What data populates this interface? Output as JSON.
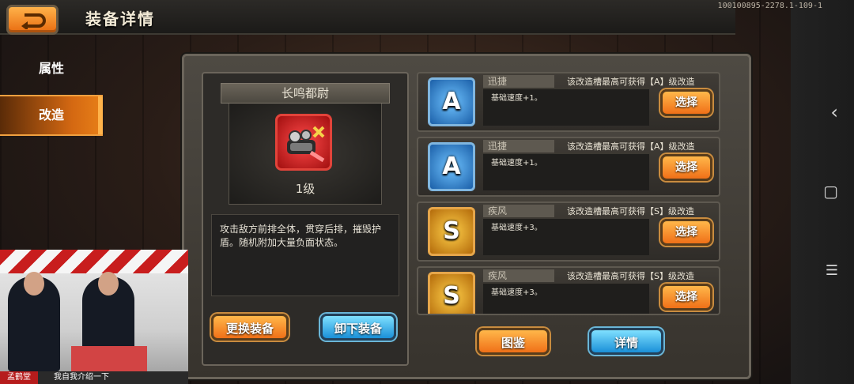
{
  "header": {
    "title": "装备详情",
    "code": "100100895-2278.1-109-1"
  },
  "nav": {
    "items": [
      {
        "label": "属性",
        "active": false
      },
      {
        "label": "改造",
        "active": true
      }
    ]
  },
  "equipment": {
    "name": "长鸣都尉",
    "level": "1级",
    "description": "攻击敌方前排全体，贯穿后排，摧毁护盾。随机附加大量负面状态。",
    "icon": "weapon-gauntlet-icon",
    "buttons": {
      "change": "更换装备",
      "unequip": "卸下装备"
    }
  },
  "slots": [
    {
      "grade": "A",
      "name": "迅捷",
      "info": "该改造槽最高可获得【A】级改造",
      "effect": "基础速度+1。",
      "button": "选择"
    },
    {
      "grade": "A",
      "name": "迅捷",
      "info": "该改造槽最高可获得【A】级改造",
      "effect": "基础速度+1。",
      "button": "选择"
    },
    {
      "grade": "S",
      "name": "疾风",
      "info": "该改造槽最高可获得【S】级改造",
      "effect": "基础速度+3。",
      "button": "选择"
    },
    {
      "grade": "S",
      "name": "疾风",
      "info": "该改造槽最高可获得【S】级改造",
      "effect": "基础速度+3。",
      "button": "选择"
    }
  ],
  "bottom_buttons": {
    "catalog": "图鉴",
    "details": "详情"
  },
  "system_nav": {
    "back": "‹",
    "home": "▢",
    "menu": "☰"
  },
  "stream": {
    "tag": "孟鹤堂",
    "caption": "我自我介绍一下"
  }
}
